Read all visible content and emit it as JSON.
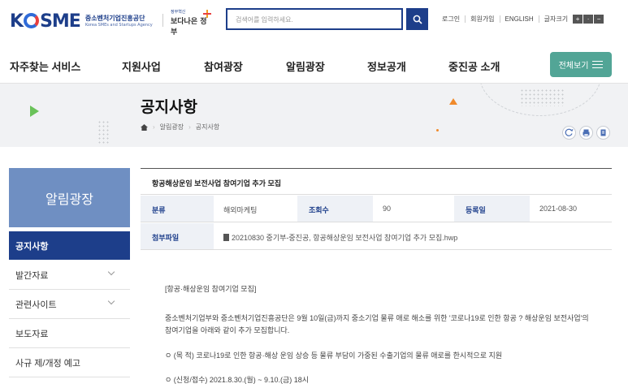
{
  "header": {
    "logo_text": "KOSME",
    "logo_ko": "중소벤처기업진흥공단",
    "logo_en": "Korea SMEs and Startups Agency",
    "gov_slogan_small": "정부혁신",
    "gov_slogan": "보다나은 정부",
    "search_placeholder": "검색어를 입력하세요.",
    "util_links": [
      "로그인",
      "회원가입",
      "ENGLISH",
      "글자크기"
    ]
  },
  "gnb": {
    "items": [
      "자주찾는 서비스",
      "지원사업",
      "참여광장",
      "알림광장",
      "정보공개",
      "중진공 소개"
    ],
    "all_menu_label": "전체보기"
  },
  "page": {
    "title": "공지사항",
    "breadcrumb": [
      "알림광장",
      "공지사항"
    ]
  },
  "lnb": {
    "title": "알림광장",
    "items": [
      {
        "label": "공지사항",
        "active": true
      },
      {
        "label": "발간자료",
        "active": false
      },
      {
        "label": "관련사이트",
        "active": false
      },
      {
        "label": "보도자료",
        "active": false
      },
      {
        "label": "사규 제/개정 예고",
        "active": false
      }
    ]
  },
  "board": {
    "subject": "항공해상운임 보전사업 참여기업 추가 모집",
    "category_label": "분류",
    "category_value": "해외마케팅",
    "views_label": "조회수",
    "views_value": "90",
    "date_label": "등록일",
    "date_value": "2021-08-30",
    "attach_label": "첨부파일",
    "attach_value": "20210830 중기부-중진공, 항공해상운임 보전사업 참여기업 추가 모집.hwp"
  },
  "content": {
    "lines": [
      "[항공·해상운임 참여기업 모집]",
      "중소벤처기업부와 중소벤처기업진흥공단은 9월 10일(금)까지 중소기업 물류 애로 해소를 위한 '코로나19로 인한 항공 ? 해상운임 보전사업'의 참여기업을 아래와 같이 추가 모집합니다.",
      "ㅇ (목 적) 코로나19로 인한 항공·해상 운임 상승 등 물류 부담이 가중된 수출기업의 물류 애로를 한시적으로 지원",
      "ㅇ (신청/접수) 2021.8.30.(월) ~ 9.10.(금) 18시"
    ]
  },
  "colors": {
    "brand_navy": "#1d3e8a",
    "lnb_title_blue": "#6f8fc2",
    "all_menu_green": "#52a596",
    "table_header_bg": "#eef1f6"
  }
}
